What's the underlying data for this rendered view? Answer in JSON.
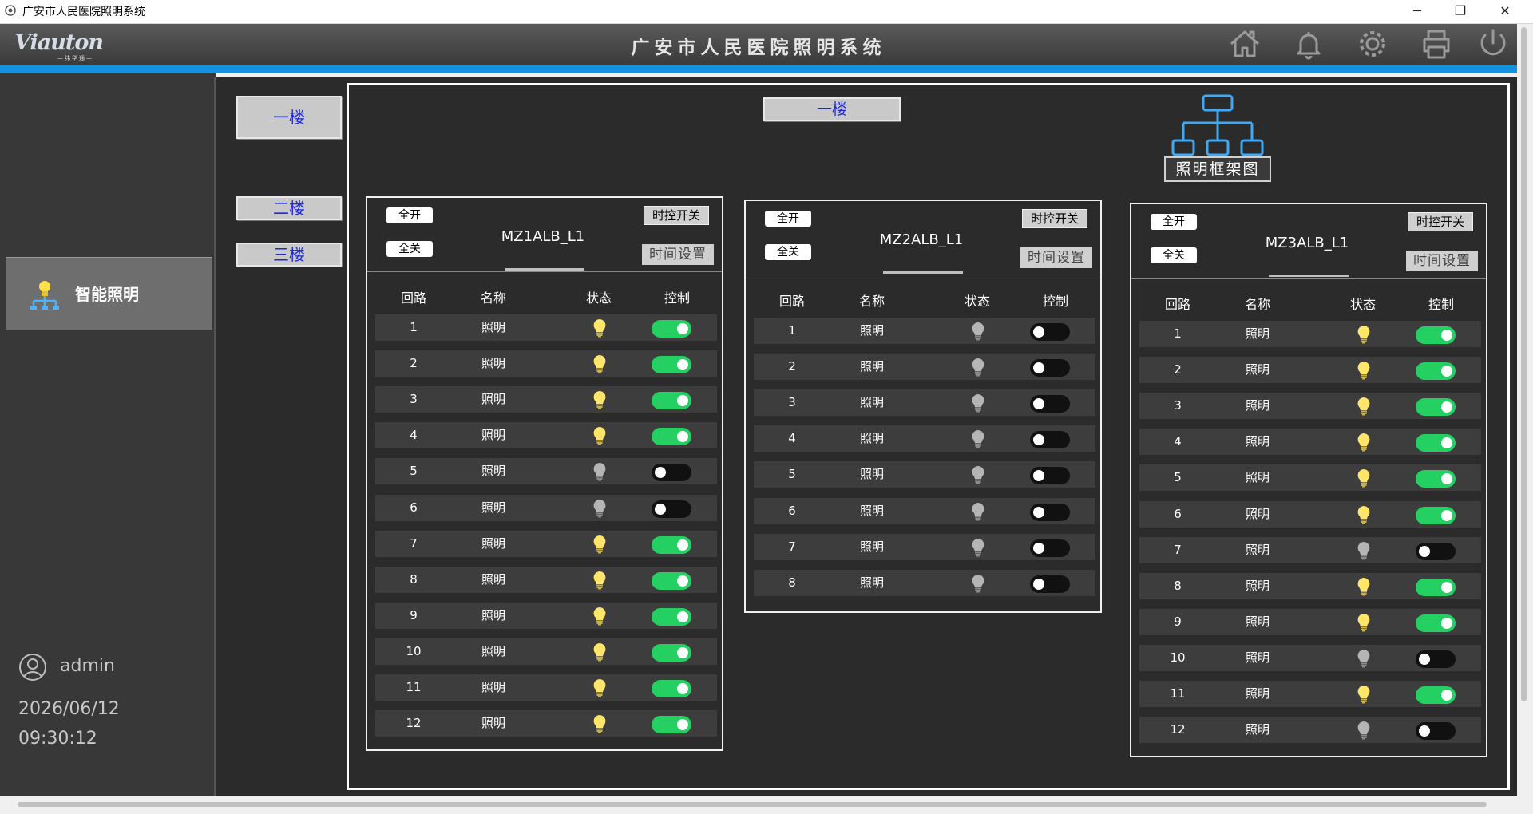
{
  "window": {
    "title": "广安市人民医院照明系统",
    "controls": {
      "minimize": "─",
      "restore": "❐",
      "close": "✕"
    }
  },
  "header": {
    "logo_text": "Viauton",
    "logo_sub": "—纬华通—",
    "app_title": "广安市人民医院照明系统",
    "icons": [
      "home-icon",
      "bell-icon",
      "gear-icon",
      "printer-icon",
      "power-icon"
    ]
  },
  "sidebar": {
    "nav_item": {
      "label": "智能照明",
      "icon": "lightbulb-network-icon"
    },
    "user": "admin",
    "date": "2026/06/12",
    "time": "09:30:12"
  },
  "floors": {
    "buttons": [
      "一楼",
      "二楼",
      "三楼"
    ],
    "current_title": "一楼",
    "diagram_label": "照明框架图"
  },
  "card_labels": {
    "all_on": "全开",
    "all_off": "全关",
    "timer_switch": "时控开关",
    "time_settings": "时间设置",
    "col_circuit": "回路",
    "col_name": "名称",
    "col_status": "状态",
    "col_control": "控制"
  },
  "colors": {
    "toggle_on": "#23d061",
    "bulb_on": "#ffe66b",
    "bulb_off": "#b5b5b5",
    "accent_bar": "#1592de"
  },
  "cards": [
    {
      "name": "MZ1ALB_L1",
      "rows": [
        {
          "n": "1",
          "name": "照明",
          "on": true
        },
        {
          "n": "2",
          "name": "照明",
          "on": true
        },
        {
          "n": "3",
          "name": "照明",
          "on": true
        },
        {
          "n": "4",
          "name": "照明",
          "on": true
        },
        {
          "n": "5",
          "name": "照明",
          "on": false
        },
        {
          "n": "6",
          "name": "照明",
          "on": false
        },
        {
          "n": "7",
          "name": "照明",
          "on": true
        },
        {
          "n": "8",
          "name": "照明",
          "on": true
        },
        {
          "n": "9",
          "name": "照明",
          "on": true
        },
        {
          "n": "10",
          "name": "照明",
          "on": true
        },
        {
          "n": "11",
          "name": "照明",
          "on": true
        },
        {
          "n": "12",
          "name": "照明",
          "on": true
        }
      ]
    },
    {
      "name": "MZ2ALB_L1",
      "rows": [
        {
          "n": "1",
          "name": "照明",
          "on": false
        },
        {
          "n": "2",
          "name": "照明",
          "on": false
        },
        {
          "n": "3",
          "name": "照明",
          "on": false
        },
        {
          "n": "4",
          "name": "照明",
          "on": false
        },
        {
          "n": "5",
          "name": "照明",
          "on": false
        },
        {
          "n": "6",
          "name": "照明",
          "on": false
        },
        {
          "n": "7",
          "name": "照明",
          "on": false
        },
        {
          "n": "8",
          "name": "照明",
          "on": false
        }
      ]
    },
    {
      "name": "MZ3ALB_L1",
      "rows": [
        {
          "n": "1",
          "name": "照明",
          "on": true
        },
        {
          "n": "2",
          "name": "照明",
          "on": true
        },
        {
          "n": "3",
          "name": "照明",
          "on": true
        },
        {
          "n": "4",
          "name": "照明",
          "on": true
        },
        {
          "n": "5",
          "name": "照明",
          "on": true
        },
        {
          "n": "6",
          "name": "照明",
          "on": true
        },
        {
          "n": "7",
          "name": "照明",
          "on": false
        },
        {
          "n": "8",
          "name": "照明",
          "on": true
        },
        {
          "n": "9",
          "name": "照明",
          "on": true
        },
        {
          "n": "10",
          "name": "照明",
          "on": false
        },
        {
          "n": "11",
          "name": "照明",
          "on": true
        },
        {
          "n": "12",
          "name": "照明",
          "on": false
        }
      ]
    }
  ]
}
